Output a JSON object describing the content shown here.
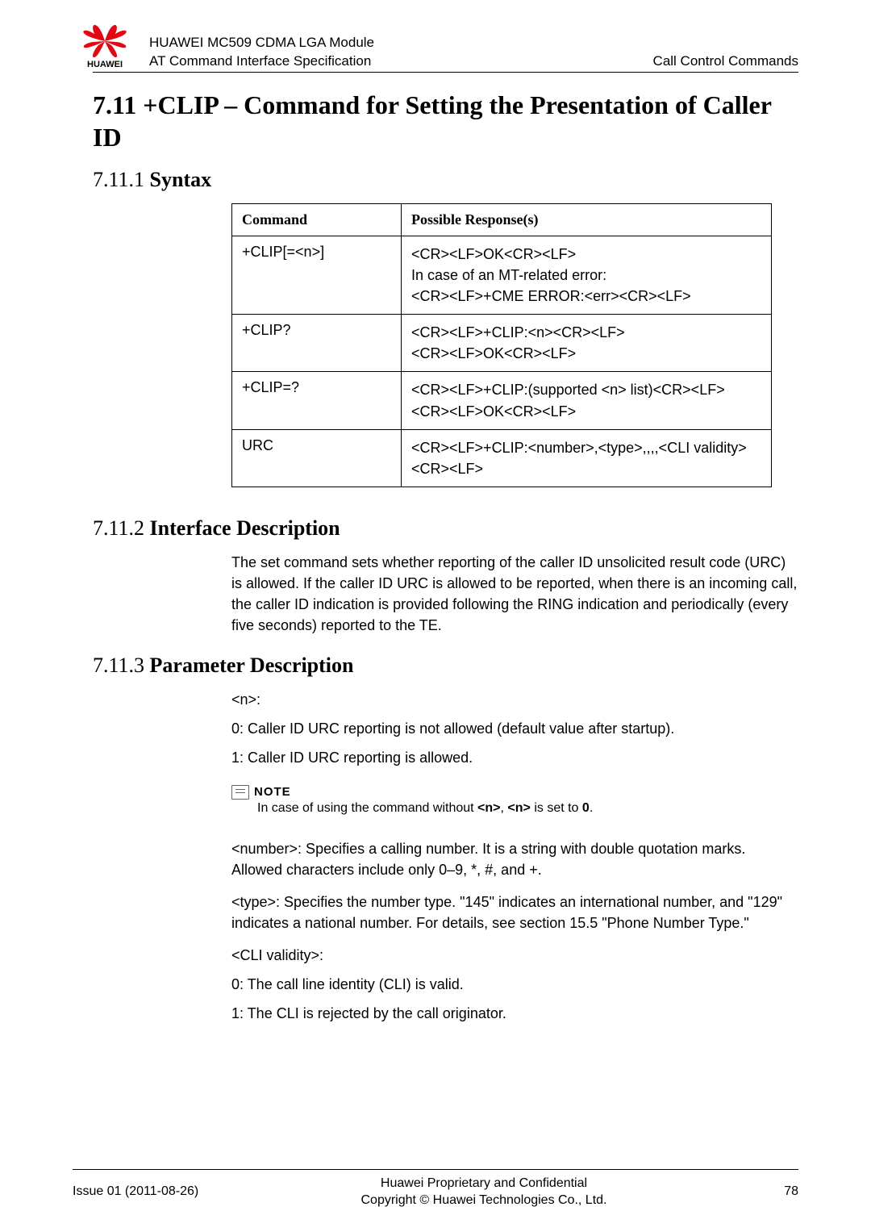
{
  "header": {
    "brand": "HUAWEI",
    "line1": "HUAWEI MC509 CDMA LGA Module",
    "line2": "AT Command Interface Specification",
    "right": "Call Control Commands"
  },
  "section": {
    "title": "7.11 +CLIP – Command for Setting the Presentation of Caller ID"
  },
  "syntax": {
    "heading_num": "7.11.1",
    "heading_text": "Syntax",
    "th_cmd": "Command",
    "th_resp": "Possible Response(s)",
    "rows": [
      {
        "cmd": "+CLIP[=<n>]",
        "resp": [
          "<CR><LF>OK<CR><LF>",
          "In case of an MT-related error:",
          "<CR><LF>+CME ERROR:<err><CR><LF>"
        ]
      },
      {
        "cmd": "+CLIP?",
        "resp": [
          "<CR><LF>+CLIP:<n><CR><LF>",
          "<CR><LF>OK<CR><LF>"
        ]
      },
      {
        "cmd": "+CLIP=?",
        "resp": [
          "<CR><LF>+CLIP:(supported <n> list)<CR><LF>",
          "<CR><LF>OK<CR><LF>"
        ]
      },
      {
        "cmd": "URC",
        "resp": [
          "<CR><LF>+CLIP:<number>,<type>,,,,<CLI validity><CR><LF>"
        ]
      }
    ]
  },
  "iface": {
    "heading_num": "7.11.2",
    "heading_text": "Interface Description",
    "body": "The set command sets whether reporting of the caller ID unsolicited result code (URC) is allowed. If the caller ID URC is allowed to be reported, when there is an incoming call, the caller ID indication is provided following the RING indication and periodically (every five seconds) reported to the TE."
  },
  "params": {
    "heading_num": "7.11.3",
    "heading_text": "Parameter Description",
    "n_label": "<n>:",
    "n0": "0: Caller ID URC reporting is not allowed (default value after startup).",
    "n1": "1: Caller ID URC reporting is allowed.",
    "note_word": "NOTE",
    "note_body": "In case of using the command without <n>, <n> is set to 0.",
    "number": "<number>: Specifies a calling number. It is a string with double quotation marks. Allowed characters include only 0–9, *, #, and +.",
    "type": "<type>: Specifies the number type. \"145\" indicates an international number, and \"129\" indicates a national number. For details, see section 15.5 \"Phone Number Type.\"",
    "cli_label": "<CLI validity>:",
    "cli0": "0: The call line identity (CLI) is valid.",
    "cli1": "1: The CLI is rejected by the call originator."
  },
  "footer": {
    "left": "Issue 01 (2011-08-26)",
    "center1": "Huawei Proprietary and Confidential",
    "center2": "Copyright © Huawei Technologies Co., Ltd.",
    "page": "78"
  }
}
